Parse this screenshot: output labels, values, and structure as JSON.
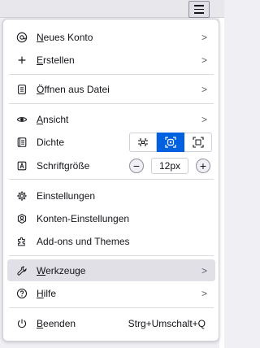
{
  "menu": {
    "new_account": "Neues Konto",
    "new_account_key": "N",
    "new_account_rest": "eues Konto",
    "create_key": "E",
    "create_rest": "rstellen",
    "open_file_key": "Ö",
    "open_file_rest": "ffnen aus Datei",
    "view_key": "A",
    "view_rest": "nsicht",
    "density": "Dichte",
    "font_size": "Schriftgröße",
    "font_size_value": "12px",
    "font_minus": "−",
    "font_plus": "+",
    "settings": "Einstellungen",
    "account_settings": "Konten-Einstellungen",
    "addons": "Add-ons und Themes",
    "tools_key": "W",
    "tools_rest": "erkzeuge",
    "help_key": "H",
    "help_rest": "ilfe",
    "quit_key": "B",
    "quit_rest": "eenden",
    "quit_shortcut": "Strg+Umschalt+Q",
    "chevron": ">"
  },
  "density_options": [
    "compact",
    "normal",
    "touch"
  ],
  "density_selected": "normal",
  "colors": {
    "accent": "#0061e0",
    "hover_bg": "#e0e0e6",
    "text": "#15141a"
  }
}
